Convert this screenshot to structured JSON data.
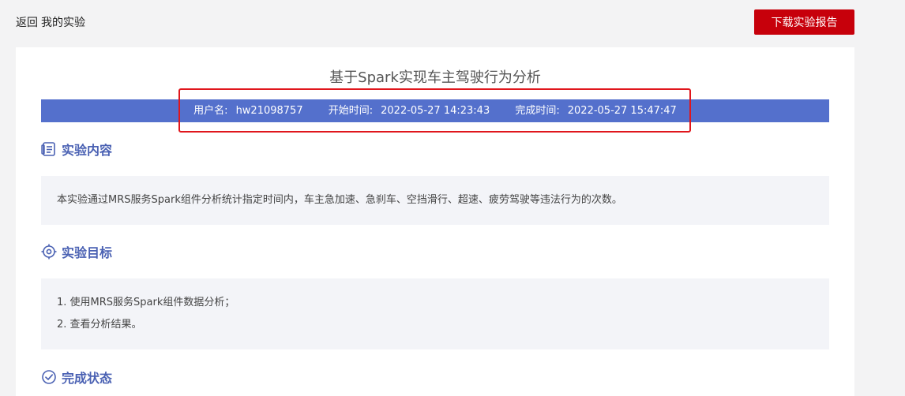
{
  "nav": {
    "back_label": "返回",
    "breadcrumb": "我的实验"
  },
  "toolbar": {
    "download_label": "下载实验报告"
  },
  "experiment": {
    "title": "基于Spark实现车主驾驶行为分析",
    "username_label": "用户名:",
    "username": "hw21098757",
    "start_label": "开始时间:",
    "start_time": "2022-05-27 14:23:43",
    "finish_label": "完成时间:",
    "finish_time": "2022-05-27 15:47:47"
  },
  "sections": {
    "content": {
      "icon": "document-list-icon",
      "heading": "实验内容",
      "text": "本实验通过MRS服务Spark组件分析统计指定时间内，车主急加速、急刹车、空挡滑行、超速、疲劳驾驶等违法行为的次数。"
    },
    "goals": {
      "icon": "target-icon",
      "heading": "实验目标",
      "items": [
        "1. 使用MRS服务Spark组件数据分析；",
        "2. 查看分析结果。"
      ]
    },
    "status": {
      "icon": "check-circle-icon",
      "heading": "完成状态"
    }
  },
  "colors": {
    "brand_red": "#c7000b",
    "info_bar": "#5470cc",
    "section_heading": "#4a61b3",
    "highlight": "#e0161c"
  }
}
